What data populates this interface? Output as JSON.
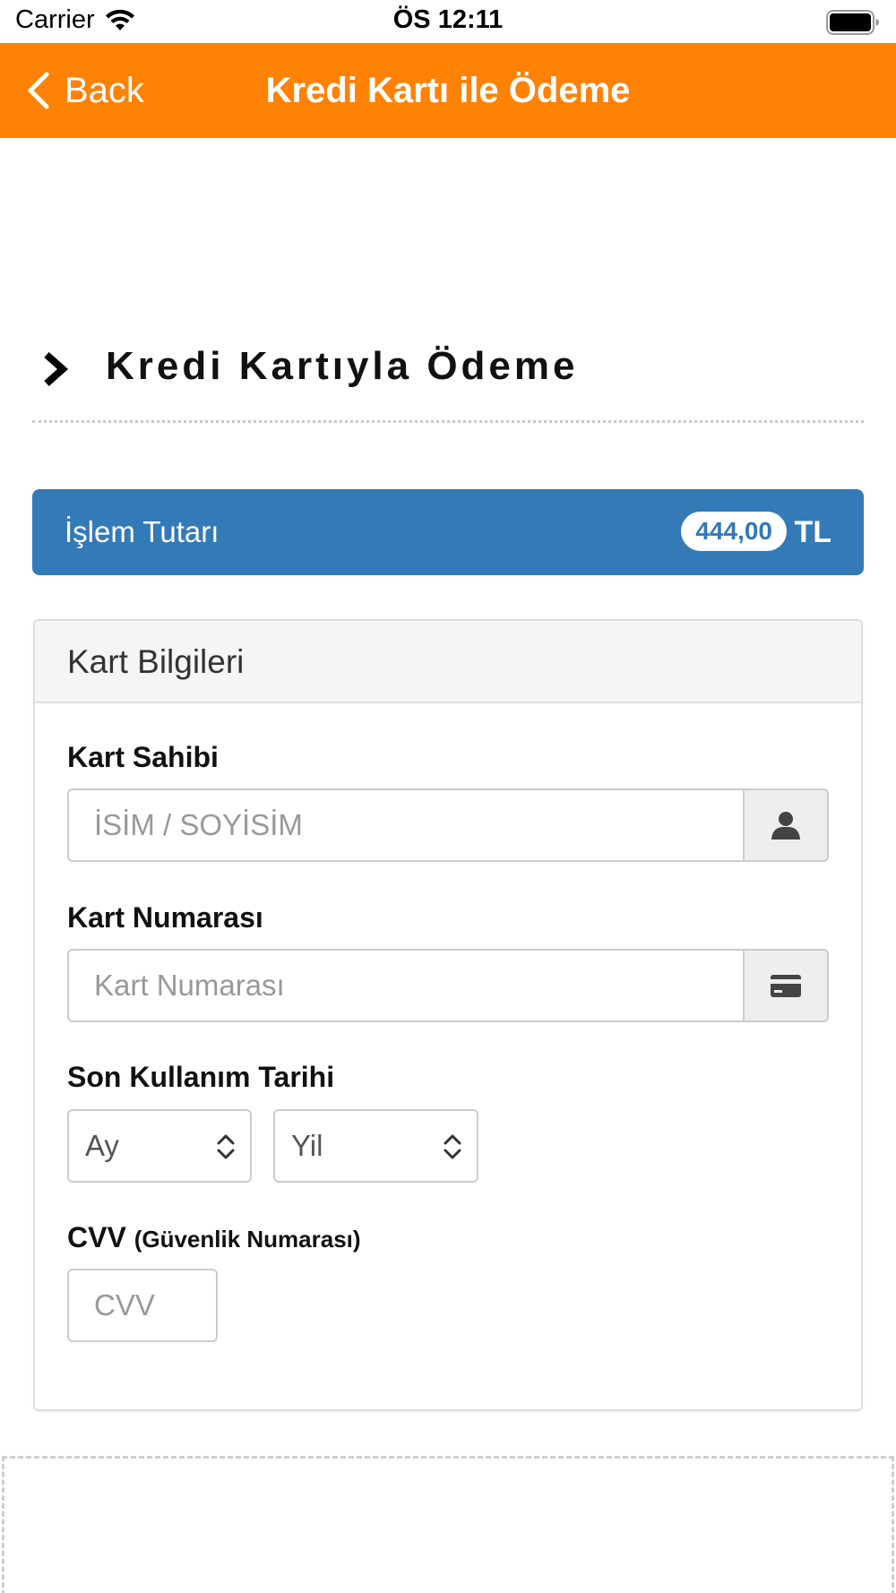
{
  "status_bar": {
    "carrier": "Carrier",
    "time": "ÖS 12:11",
    "icons": [
      "wifi-icon",
      "battery-icon"
    ]
  },
  "nav": {
    "back_label": "Back",
    "title": "Kredi Kartı ile Ödeme",
    "background_color": "#ff8205"
  },
  "section": {
    "title": "Kredi Kartıyla Ödeme"
  },
  "amount": {
    "label": "İşlem Tutarı",
    "value": "444,00",
    "currency": "TL",
    "background_color": "#337ab7"
  },
  "card_panel": {
    "title": "Kart Bilgileri",
    "holder": {
      "label": "Kart Sahibi",
      "placeholder": "İSİM / SOYİSİM",
      "value": "",
      "icon": "user-icon"
    },
    "number": {
      "label": "Kart Numarası",
      "placeholder": "Kart Numarası",
      "value": "",
      "icon": "credit-card-icon"
    },
    "expiry": {
      "label": "Son Kullanım Tarihi",
      "month_selected": "Ay",
      "year_selected": "Yil"
    },
    "cvv": {
      "label": "CVV",
      "label_note": "(Güvenlik Numarası)",
      "placeholder": "CVV",
      "value": ""
    }
  }
}
